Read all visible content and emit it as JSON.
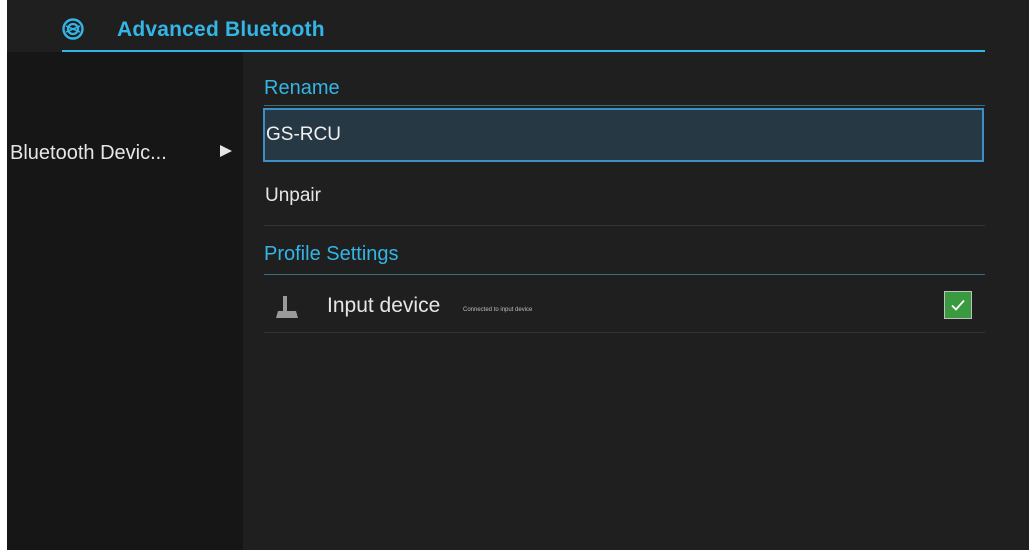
{
  "header": {
    "title": "Advanced Bluetooth",
    "icon": "bluetooth-settings-icon",
    "accent_color": "#33b5e5"
  },
  "sidebar": {
    "items": [
      {
        "label": "Bluetooth Devic...",
        "selected": true
      }
    ]
  },
  "sections": {
    "rename": {
      "header": "Rename",
      "field_value": "GS-RCU",
      "unpair_label": "Unpair"
    },
    "profile_settings": {
      "header": "Profile Settings",
      "items": [
        {
          "title": "Input device",
          "summary": "Connected to input device",
          "checked": true,
          "icon": "input-device-icon"
        }
      ]
    }
  },
  "colors": {
    "background": "#1f1f1f",
    "sidebar_background": "#161616",
    "checkbox_checked": "#3a9a3f"
  }
}
